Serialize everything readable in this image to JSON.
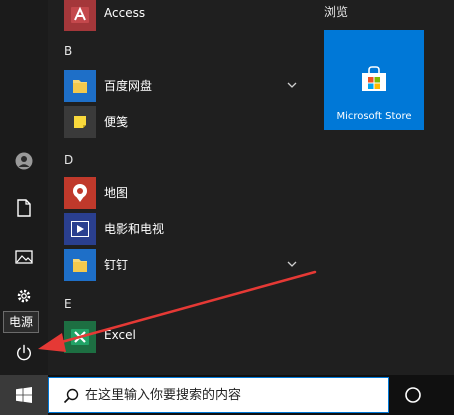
{
  "start_menu": {
    "apps": [
      {
        "group": "",
        "label": "Access",
        "icon": "access-icon",
        "expandable": false
      },
      {
        "group": "B",
        "label": "百度网盘",
        "icon": "folder-icon",
        "expandable": true
      },
      {
        "group": "",
        "label": "便笺",
        "icon": "sticky-notes-icon",
        "expandable": false
      },
      {
        "group": "D",
        "label": "地图",
        "icon": "maps-icon",
        "expandable": false
      },
      {
        "group": "",
        "label": "电影和电视",
        "icon": "movies-tv-icon",
        "expandable": false
      },
      {
        "group": "",
        "label": "钉钉",
        "icon": "folder-icon",
        "expandable": true
      },
      {
        "group": "E",
        "label": "Excel",
        "icon": "excel-icon",
        "expandable": false
      }
    ],
    "groups": [
      "B",
      "D",
      "E"
    ],
    "tile_section": "浏览",
    "store_tile": {
      "label": "Microsoft Store",
      "color": "#0078d7"
    }
  },
  "rail": {
    "power_tooltip": "电源"
  },
  "taskbar": {
    "search_placeholder": "在这里输入你要搜索的内容"
  },
  "colors": {
    "accent": "#0078d7",
    "annotation_arrow": "#e53935"
  }
}
